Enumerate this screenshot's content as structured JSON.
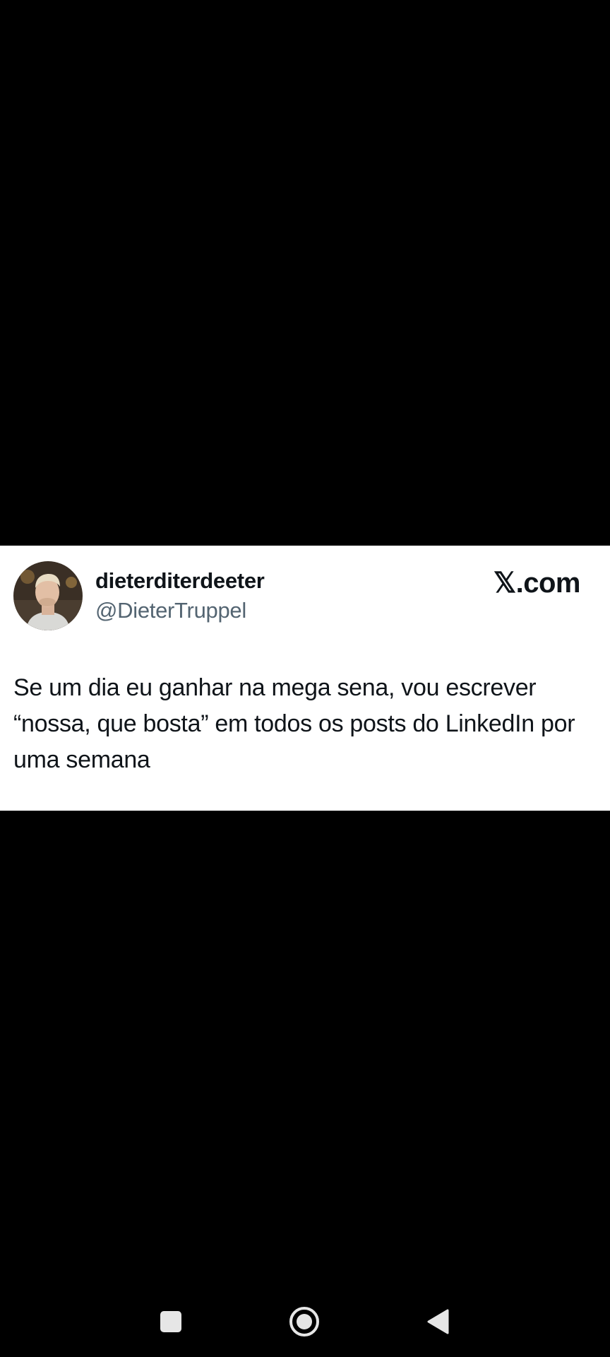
{
  "tweet": {
    "display_name": "dieterditerdeeter",
    "handle": "@DieterTruppel",
    "brand": "𝕏.com",
    "text": "Se um dia eu ganhar na mega sena, vou escrever “nossa, que bosta” em todos os posts do LinkedIn por uma semana"
  },
  "colors": {
    "background": "#000000",
    "card": "#ffffff",
    "name": "#0f1419",
    "handle": "#536471",
    "nav_icons": "#e6e6e6"
  },
  "nav_bar": {
    "icons": [
      "recents-icon",
      "home-icon",
      "back-icon"
    ]
  }
}
